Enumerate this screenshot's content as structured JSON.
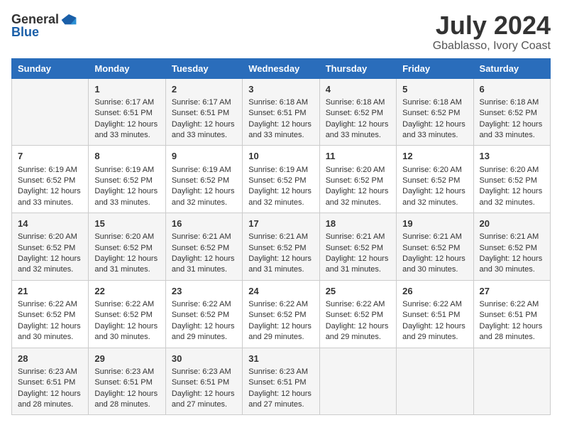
{
  "logo": {
    "general": "General",
    "blue": "Blue"
  },
  "title": {
    "month_year": "July 2024",
    "location": "Gbablasso, Ivory Coast"
  },
  "days_of_week": [
    "Sunday",
    "Monday",
    "Tuesday",
    "Wednesday",
    "Thursday",
    "Friday",
    "Saturday"
  ],
  "weeks": [
    [
      {
        "day": "",
        "info": ""
      },
      {
        "day": "1",
        "info": "Sunrise: 6:17 AM\nSunset: 6:51 PM\nDaylight: 12 hours\nand 33 minutes."
      },
      {
        "day": "2",
        "info": "Sunrise: 6:17 AM\nSunset: 6:51 PM\nDaylight: 12 hours\nand 33 minutes."
      },
      {
        "day": "3",
        "info": "Sunrise: 6:18 AM\nSunset: 6:51 PM\nDaylight: 12 hours\nand 33 minutes."
      },
      {
        "day": "4",
        "info": "Sunrise: 6:18 AM\nSunset: 6:52 PM\nDaylight: 12 hours\nand 33 minutes."
      },
      {
        "day": "5",
        "info": "Sunrise: 6:18 AM\nSunset: 6:52 PM\nDaylight: 12 hours\nand 33 minutes."
      },
      {
        "day": "6",
        "info": "Sunrise: 6:18 AM\nSunset: 6:52 PM\nDaylight: 12 hours\nand 33 minutes."
      }
    ],
    [
      {
        "day": "7",
        "info": "Sunrise: 6:19 AM\nSunset: 6:52 PM\nDaylight: 12 hours\nand 33 minutes."
      },
      {
        "day": "8",
        "info": "Sunrise: 6:19 AM\nSunset: 6:52 PM\nDaylight: 12 hours\nand 33 minutes."
      },
      {
        "day": "9",
        "info": "Sunrise: 6:19 AM\nSunset: 6:52 PM\nDaylight: 12 hours\nand 32 minutes."
      },
      {
        "day": "10",
        "info": "Sunrise: 6:19 AM\nSunset: 6:52 PM\nDaylight: 12 hours\nand 32 minutes."
      },
      {
        "day": "11",
        "info": "Sunrise: 6:20 AM\nSunset: 6:52 PM\nDaylight: 12 hours\nand 32 minutes."
      },
      {
        "day": "12",
        "info": "Sunrise: 6:20 AM\nSunset: 6:52 PM\nDaylight: 12 hours\nand 32 minutes."
      },
      {
        "day": "13",
        "info": "Sunrise: 6:20 AM\nSunset: 6:52 PM\nDaylight: 12 hours\nand 32 minutes."
      }
    ],
    [
      {
        "day": "14",
        "info": "Sunrise: 6:20 AM\nSunset: 6:52 PM\nDaylight: 12 hours\nand 32 minutes."
      },
      {
        "day": "15",
        "info": "Sunrise: 6:20 AM\nSunset: 6:52 PM\nDaylight: 12 hours\nand 31 minutes."
      },
      {
        "day": "16",
        "info": "Sunrise: 6:21 AM\nSunset: 6:52 PM\nDaylight: 12 hours\nand 31 minutes."
      },
      {
        "day": "17",
        "info": "Sunrise: 6:21 AM\nSunset: 6:52 PM\nDaylight: 12 hours\nand 31 minutes."
      },
      {
        "day": "18",
        "info": "Sunrise: 6:21 AM\nSunset: 6:52 PM\nDaylight: 12 hours\nand 31 minutes."
      },
      {
        "day": "19",
        "info": "Sunrise: 6:21 AM\nSunset: 6:52 PM\nDaylight: 12 hours\nand 30 minutes."
      },
      {
        "day": "20",
        "info": "Sunrise: 6:21 AM\nSunset: 6:52 PM\nDaylight: 12 hours\nand 30 minutes."
      }
    ],
    [
      {
        "day": "21",
        "info": "Sunrise: 6:22 AM\nSunset: 6:52 PM\nDaylight: 12 hours\nand 30 minutes."
      },
      {
        "day": "22",
        "info": "Sunrise: 6:22 AM\nSunset: 6:52 PM\nDaylight: 12 hours\nand 30 minutes."
      },
      {
        "day": "23",
        "info": "Sunrise: 6:22 AM\nSunset: 6:52 PM\nDaylight: 12 hours\nand 29 minutes."
      },
      {
        "day": "24",
        "info": "Sunrise: 6:22 AM\nSunset: 6:52 PM\nDaylight: 12 hours\nand 29 minutes."
      },
      {
        "day": "25",
        "info": "Sunrise: 6:22 AM\nSunset: 6:52 PM\nDaylight: 12 hours\nand 29 minutes."
      },
      {
        "day": "26",
        "info": "Sunrise: 6:22 AM\nSunset: 6:51 PM\nDaylight: 12 hours\nand 29 minutes."
      },
      {
        "day": "27",
        "info": "Sunrise: 6:22 AM\nSunset: 6:51 PM\nDaylight: 12 hours\nand 28 minutes."
      }
    ],
    [
      {
        "day": "28",
        "info": "Sunrise: 6:23 AM\nSunset: 6:51 PM\nDaylight: 12 hours\nand 28 minutes."
      },
      {
        "day": "29",
        "info": "Sunrise: 6:23 AM\nSunset: 6:51 PM\nDaylight: 12 hours\nand 28 minutes."
      },
      {
        "day": "30",
        "info": "Sunrise: 6:23 AM\nSunset: 6:51 PM\nDaylight: 12 hours\nand 27 minutes."
      },
      {
        "day": "31",
        "info": "Sunrise: 6:23 AM\nSunset: 6:51 PM\nDaylight: 12 hours\nand 27 minutes."
      },
      {
        "day": "",
        "info": ""
      },
      {
        "day": "",
        "info": ""
      },
      {
        "day": "",
        "info": ""
      }
    ]
  ]
}
